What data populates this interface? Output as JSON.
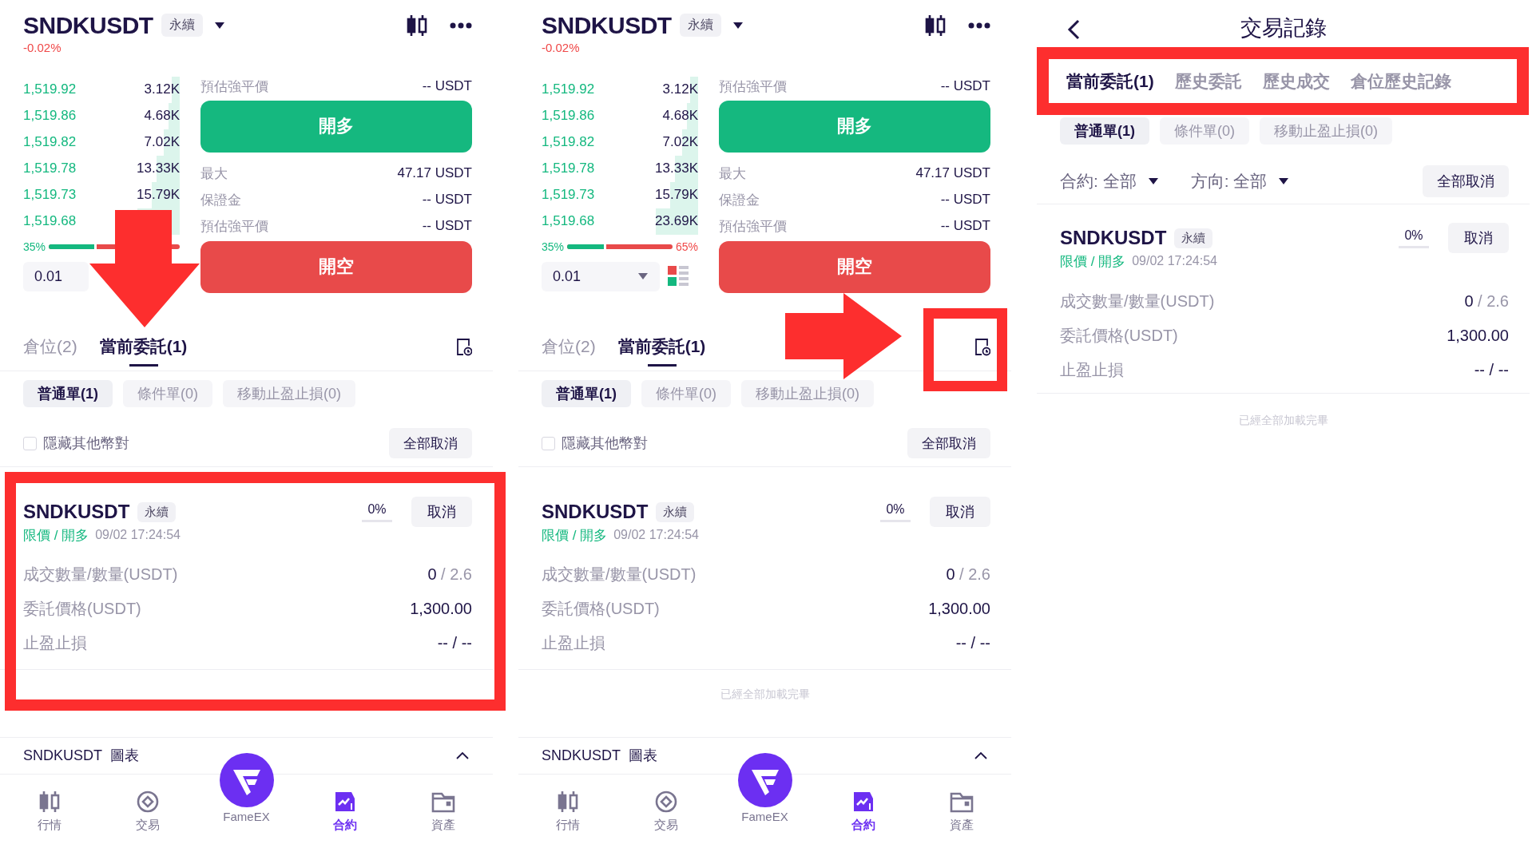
{
  "panels": [
    {
      "kind": "trade",
      "header": {
        "symbol": "SNDKUSDT",
        "tag": "永續",
        "change": "-0.02%"
      },
      "order_book": {
        "rows": [
          {
            "price": "1,519.92",
            "amount": "3.12K"
          },
          {
            "price": "1,519.86",
            "amount": "4.68K"
          },
          {
            "price": "1,519.82",
            "amount": "7.02K"
          },
          {
            "price": "1,519.78",
            "amount": "13.33K"
          },
          {
            "price": "1,519.73",
            "amount": "15.79K"
          },
          {
            "price": "1,519.68"
          }
        ],
        "ratio": {
          "buy": "35%",
          "level": 0.35
        }
      },
      "quantity": {
        "value": "0.01",
        "dropdown": false,
        "depth_toggle": false
      },
      "form": {
        "top_rows": [
          {
            "label": "預估強平價",
            "value": "-- USDT"
          }
        ],
        "buy_button": "開多",
        "bottom_rows": [
          {
            "label": "最大",
            "value": "47.17 USDT"
          },
          {
            "label": "保證金",
            "value": "-- USDT"
          },
          {
            "label": "預估強平價",
            "value": "-- USDT"
          }
        ],
        "sell_button": "開空"
      },
      "tabs": [
        {
          "label": "倉位(2)",
          "selected": false
        },
        {
          "label": "當前委託(1)",
          "selected": true
        }
      ],
      "order_types": [
        {
          "label": "普通單(1)",
          "selected": true
        },
        {
          "label": "條件單(0)",
          "selected": false
        },
        {
          "label": "移動止盈止損(0)",
          "selected": false
        }
      ],
      "hide_others": {
        "label": "隱藏其他幣對",
        "checked": false
      },
      "cancel_all": "全部取消",
      "orders": [
        {
          "symbol": "SNDKUSDT",
          "tag": "永續",
          "fill_percent": "0%",
          "cancel": "取消",
          "type": "限價 / 開多",
          "time": "09/02 17:24:54",
          "rows": [
            {
              "label": "成交數量/數量(USDT)",
              "value": "0",
              "value_extra": "/ 2.6"
            },
            {
              "label": "委託價格(USDT)",
              "value": "1,300.00"
            },
            {
              "label": "止盈止損",
              "value": "-- / --"
            }
          ]
        }
      ],
      "chart_bar": "SNDKUSDT  圖表",
      "nav": [
        {
          "kind": "tab",
          "label": "行情",
          "selected": false
        },
        {
          "kind": "tab",
          "label": "交易",
          "selected": false
        },
        {
          "kind": "logo",
          "label": "FameEX",
          "selected": false
        },
        {
          "kind": "tab",
          "label": "合約",
          "selected": true
        },
        {
          "kind": "tab",
          "label": "資產",
          "selected": false
        }
      ],
      "annotations": [
        {
          "kind": "down-arrow"
        },
        {
          "kind": "orders-frame"
        }
      ]
    },
    {
      "kind": "trade",
      "header": {
        "symbol": "SNDKUSDT",
        "tag": "永續",
        "change": "-0.02%"
      },
      "order_book": {
        "rows": [
          {
            "price": "1,519.92",
            "amount": "3.12K"
          },
          {
            "price": "1,519.86",
            "amount": "4.68K"
          },
          {
            "price": "1,519.82",
            "amount": "7.02K"
          },
          {
            "price": "1,519.78",
            "amount": "13.33K"
          },
          {
            "price": "1,519.73",
            "amount": "15.79K"
          },
          {
            "price": "1,519.68",
            "amount": "23.69K"
          }
        ],
        "ratio": {
          "buy": "35%",
          "sell": "65%",
          "level": 0.35
        }
      },
      "quantity": {
        "value": "0.01",
        "dropdown": true,
        "depth_toggle": true
      },
      "form": {
        "top_rows": [
          {
            "label": "預估強平價",
            "value": "-- USDT"
          }
        ],
        "buy_button": "開多",
        "bottom_rows": [
          {
            "label": "最大",
            "value": "47.17 USDT"
          },
          {
            "label": "保證金",
            "value": "-- USDT"
          },
          {
            "label": "預估強平價",
            "value": "-- USDT"
          }
        ],
        "sell_button": "開空"
      },
      "tabs": [
        {
          "label": "倉位(2)",
          "selected": false
        },
        {
          "label": "當前委託(1)",
          "selected": true
        }
      ],
      "order_types": [
        {
          "label": "普通單(1)",
          "selected": true
        },
        {
          "label": "條件單(0)",
          "selected": false
        },
        {
          "label": "移動止盈止損(0)",
          "selected": false
        }
      ],
      "hide_others": {
        "label": "隱藏其他幣對",
        "checked": false
      },
      "cancel_all": "全部取消",
      "orders": [
        {
          "symbol": "SNDKUSDT",
          "tag": "永續",
          "fill_percent": "0%",
          "cancel": "取消",
          "type": "限價 / 開多",
          "time": "09/02 17:24:54",
          "rows": [
            {
              "label": "成交數量/數量(USDT)",
              "value": "0",
              "value_extra": "/ 2.6"
            },
            {
              "label": "委託價格(USDT)",
              "value": "1,300.00"
            },
            {
              "label": "止盈止損",
              "value": "-- / --"
            }
          ]
        }
      ],
      "loaded_text": "已經全部加載完畢",
      "chart_bar": "SNDKUSDT  圖表",
      "nav": [
        {
          "kind": "tab",
          "label": "行情",
          "selected": false
        },
        {
          "kind": "tab",
          "label": "交易",
          "selected": false
        },
        {
          "kind": "logo",
          "label": "FameEX",
          "selected": false
        },
        {
          "kind": "tab",
          "label": "合約",
          "selected": true
        },
        {
          "kind": "tab",
          "label": "資產",
          "selected": false
        }
      ],
      "annotations": [
        {
          "kind": "right-arrow"
        },
        {
          "kind": "icon-frame"
        }
      ]
    },
    {
      "kind": "records",
      "title": "交易記錄",
      "tabs": [
        {
          "label": "當前委託(1)",
          "selected": true
        },
        {
          "label": "歷史委託",
          "selected": false
        },
        {
          "label": "歷史成交",
          "selected": false
        },
        {
          "label": "倉位歷史記錄",
          "selected": false
        }
      ],
      "order_types": [
        {
          "label": "普通單(1)",
          "selected": true
        },
        {
          "label": "條件單(0)",
          "selected": false
        },
        {
          "label": "移動止盈止損(0)",
          "selected": false
        }
      ],
      "filters": [
        {
          "label": "合約: 全部"
        },
        {
          "label": "方向: 全部"
        }
      ],
      "cancel_all": "全部取消",
      "orders": [
        {
          "symbol": "SNDKUSDT",
          "tag": "永續",
          "fill_percent": "0%",
          "cancel": "取消",
          "type": "限價 / 開多",
          "time": "09/02 17:24:54",
          "rows": [
            {
              "label": "成交數量/數量(USDT)",
              "value": "0",
              "value_extra": "/ 2.6"
            },
            {
              "label": "委託價格(USDT)",
              "value": "1,300.00"
            },
            {
              "label": "止盈止損",
              "value": "-- / --"
            }
          ]
        }
      ],
      "loaded_text": "已經全部加載完畢",
      "annotations": [
        {
          "kind": "tabs-frame"
        }
      ]
    }
  ]
}
